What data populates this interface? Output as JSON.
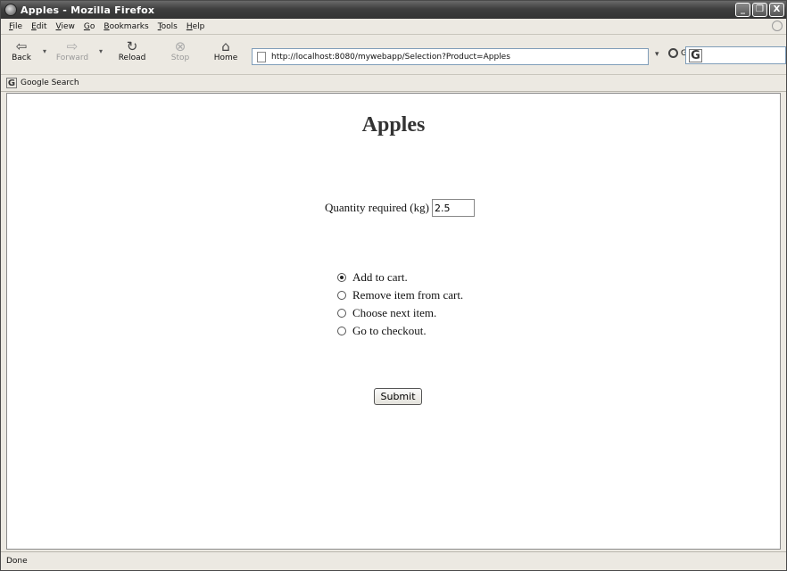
{
  "window": {
    "title": "Apples - Mozilla Firefox",
    "controls": {
      "minimize": "_",
      "restore": "❐",
      "close": "X"
    }
  },
  "menu": [
    "File",
    "Edit",
    "View",
    "Go",
    "Bookmarks",
    "Tools",
    "Help"
  ],
  "toolbar": {
    "back": "Back",
    "forward": "Forward",
    "reload": "Reload",
    "stop": "Stop",
    "home": "Home",
    "url": "http://localhost:8080/mywebapp/Selection?Product=Apples",
    "go": "Go",
    "search_logo": "G"
  },
  "bookmarks": {
    "google_search": "Google Search",
    "logo": "G"
  },
  "page": {
    "heading": "Apples",
    "quantity_label": "Quantity required (kg)",
    "quantity_value": "2.5",
    "options": [
      {
        "label": "Add to cart.",
        "selected": true
      },
      {
        "label": "Remove item from cart.",
        "selected": false
      },
      {
        "label": "Choose next item.",
        "selected": false
      },
      {
        "label": "Go to checkout.",
        "selected": false
      }
    ],
    "submit": "Submit"
  },
  "status": "Done",
  "icons": {
    "back": "back-arrow-icon",
    "forward": "forward-arrow-icon",
    "reload": "reload-icon",
    "stop": "stop-icon",
    "home": "home-icon"
  }
}
